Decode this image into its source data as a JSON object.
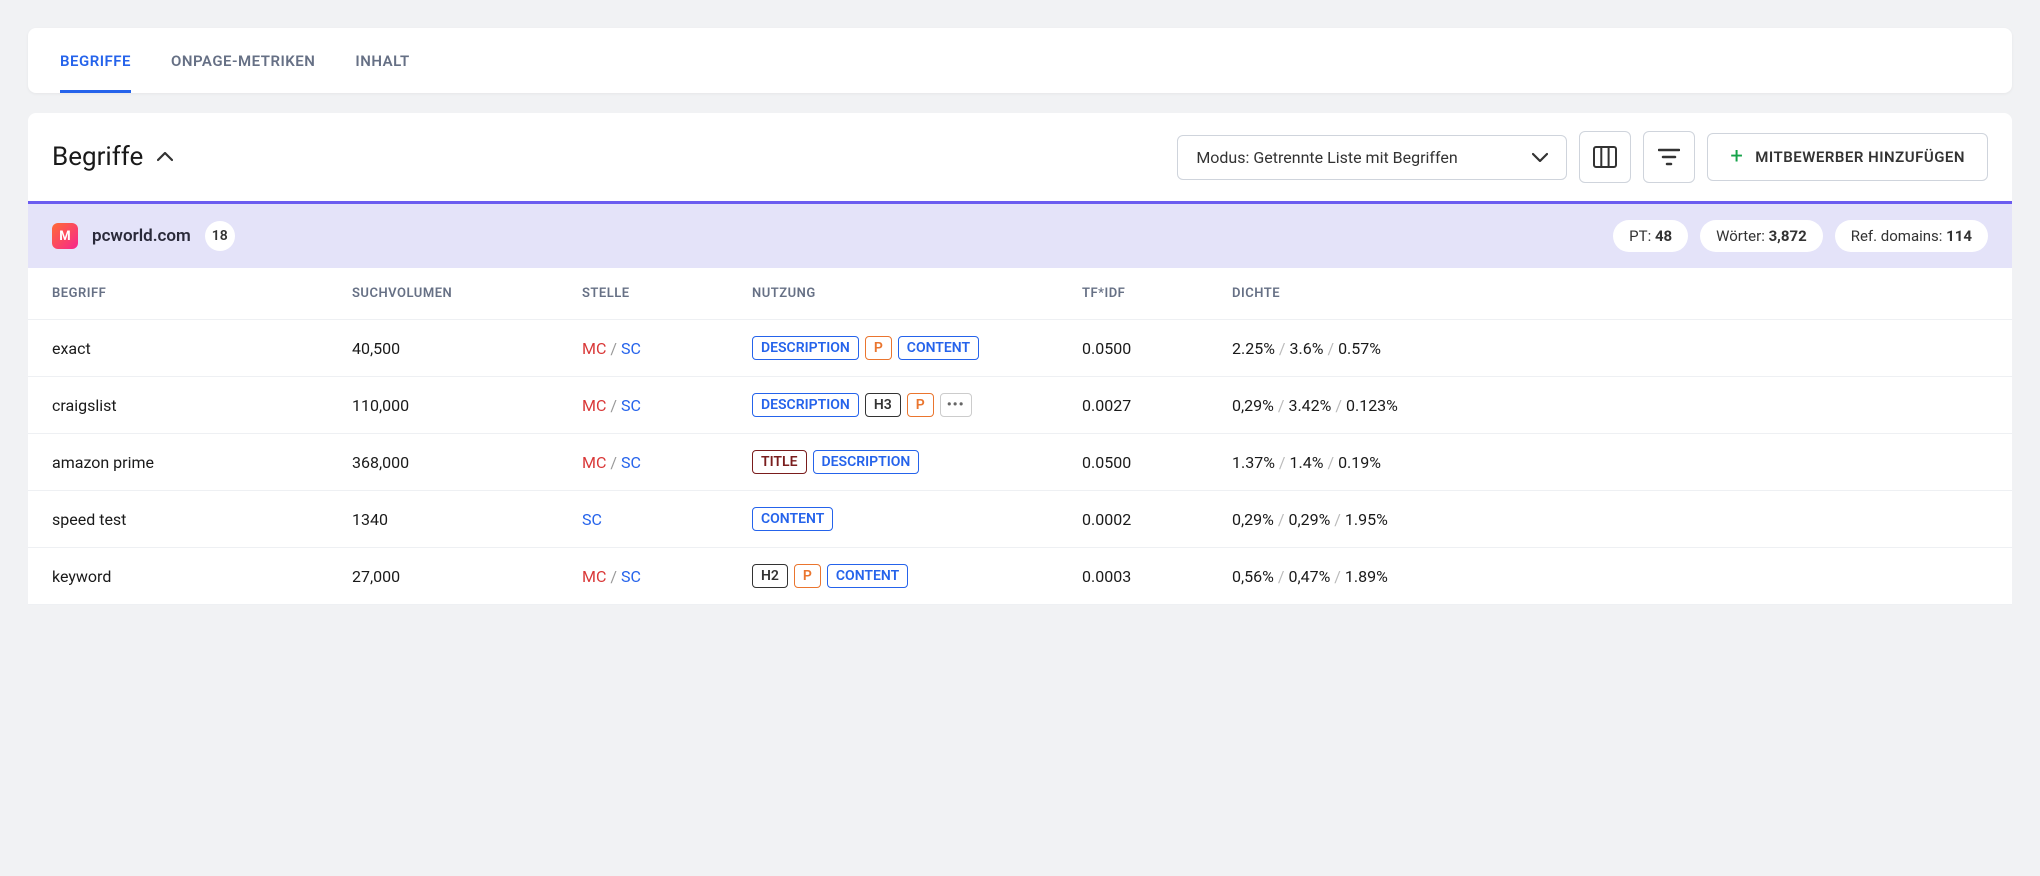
{
  "tabs": {
    "begriffe": "BEGRIFFE",
    "onpage": "ONPAGE-METRIKEN",
    "inhalt": "INHALT"
  },
  "section": {
    "title": "Begriffe"
  },
  "mode_select": {
    "label": "Modus: Getrennte Liste mit Begriffen"
  },
  "add_button": {
    "label": "MITBEWERBER HINZUFÜGEN"
  },
  "info": {
    "site": "pcworld.com",
    "count": "18",
    "pt_label": "PT:",
    "pt_value": "48",
    "words_label": "Wörter:",
    "words_value": "3,872",
    "ref_label": "Ref. domains:",
    "ref_value": "114"
  },
  "columns": {
    "begriff": "BEGRIFF",
    "suchvolumen": "SUCHVOLUMEN",
    "stelle": "STELLE",
    "nutzung": "NUTZUNG",
    "tfidf": "TF*IDF",
    "dichte": "DICHTE"
  },
  "tag_labels": {
    "description": "DESCRIPTION",
    "content": "CONTENT",
    "title": "TITLE",
    "p": "P",
    "h2": "H2",
    "h3": "H3",
    "more": "•••"
  },
  "stelle_labels": {
    "mc": "MC",
    "sc": "SC",
    "sep": "/"
  },
  "rows": [
    {
      "term": "exact",
      "vol": "40,500",
      "mc": true,
      "sc": true,
      "tags": [
        "desc",
        "p",
        "content"
      ],
      "tfidf": "0.0500",
      "d1": "2.25%",
      "d2": "3.6%",
      "d3": "0.57%"
    },
    {
      "term": "craigslist",
      "vol": "110,000",
      "mc": true,
      "sc": true,
      "tags": [
        "desc",
        "h3",
        "p",
        "more"
      ],
      "tfidf": "0.0027",
      "d1": "0,29%",
      "d2": "3.42%",
      "d3": "0.123%"
    },
    {
      "term": "amazon prime",
      "vol": "368,000",
      "mc": true,
      "sc": true,
      "tags": [
        "title",
        "desc"
      ],
      "tfidf": "0.0500",
      "d1": "1.37%",
      "d2": "1.4%",
      "d3": "0.19%"
    },
    {
      "term": "speed test",
      "vol": "1340",
      "mc": false,
      "sc": true,
      "tags": [
        "content"
      ],
      "tfidf": "0.0002",
      "d1": "0,29%",
      "d2": "0,29%",
      "d3": "1.95%"
    },
    {
      "term": "keyword",
      "vol": "27,000",
      "mc": true,
      "sc": true,
      "tags": [
        "h2",
        "p",
        "content"
      ],
      "tfidf": "0.0003",
      "d1": "0,56%",
      "d2": "0,47%",
      "d3": "1.89%"
    }
  ]
}
